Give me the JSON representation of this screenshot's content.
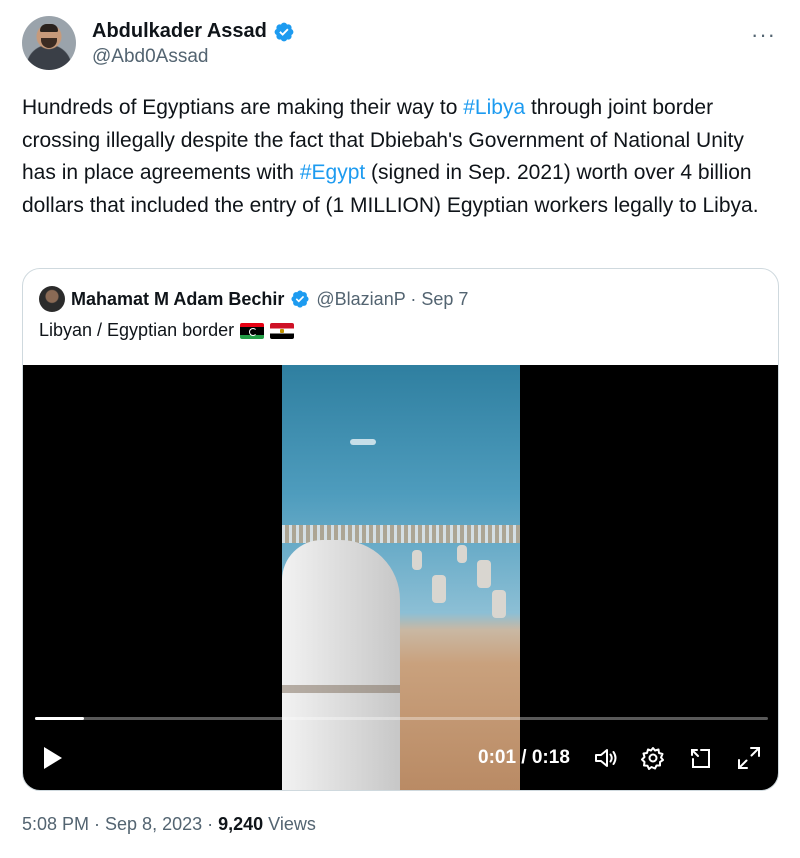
{
  "author": {
    "display_name": "Abdulkader Assad",
    "handle": "@Abd0Assad",
    "verified": true
  },
  "more_label": "···",
  "tweet": {
    "text_1": "Hundreds of Egyptians are making their way to ",
    "hashtag_1": "#Libya",
    "text_2": " through joint border crossing illegally despite the fact that Dbiebah's Government of National Unity has in place agreements with ",
    "hashtag_2": "#Egypt",
    "text_3": " (signed in Sep. 2021) worth over 4 billion dollars that included the entry of (1 MILLION) Egyptian workers legally to Libya."
  },
  "quote": {
    "display_name": "Mahamat M Adam Bechir",
    "handle_date": "@BlazianP · Sep 7",
    "text": "Libyan / Egyptian border",
    "flags": [
      "flag-libya",
      "flag-egypt"
    ]
  },
  "video": {
    "time": "0:01 / 0:18",
    "progress_fraction": 0.067,
    "icons": [
      "play-icon",
      "volume-icon",
      "settings-icon",
      "pop-out-icon",
      "fullscreen-icon"
    ]
  },
  "meta": {
    "time_date": "5:08 PM · Sep 8, 2023 · ",
    "views_count": "9,240",
    "views_label": " Views"
  },
  "colors": {
    "accent": "#1d9bf0",
    "text": "#0f1419",
    "secondary": "#536471",
    "border": "#cfd9de"
  }
}
